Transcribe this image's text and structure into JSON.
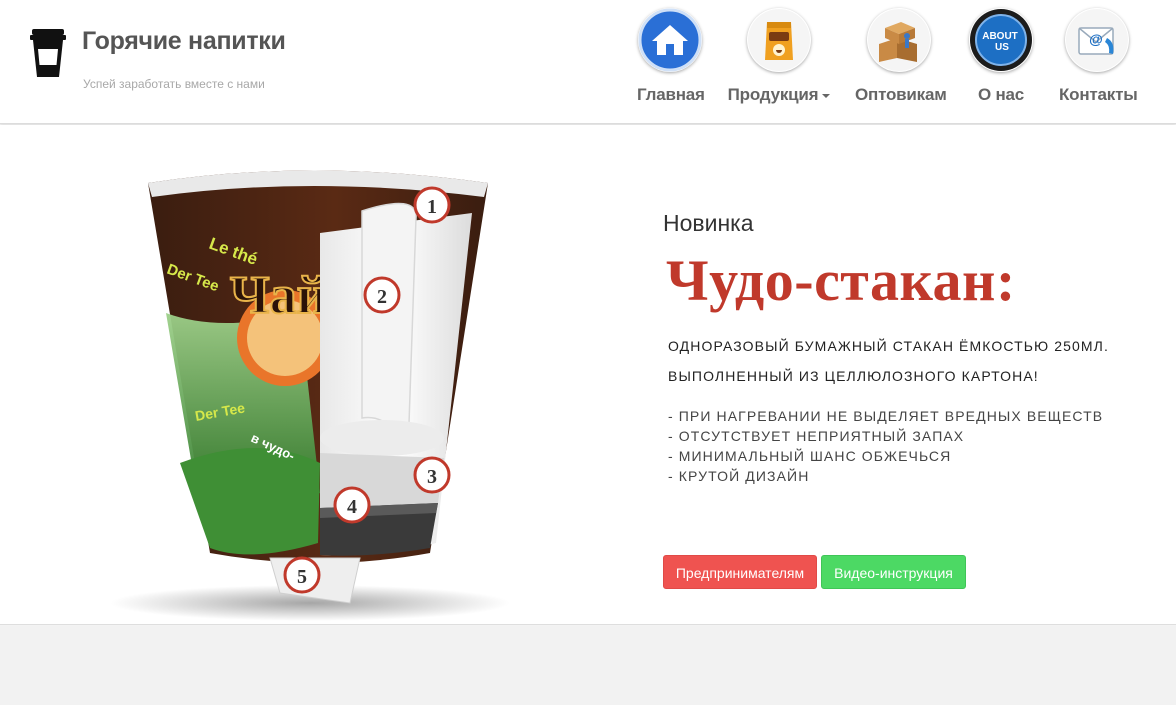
{
  "brand": {
    "title": "Горячие напитки",
    "tagline": "Успей заработать вместе с нами",
    "logo_icon": "coffee-cup-icon"
  },
  "nav": {
    "items": [
      {
        "label": "Главная",
        "icon": "home-icon",
        "dropdown": false
      },
      {
        "label": "Продукция",
        "icon": "coffee-pack-icon",
        "dropdown": true
      },
      {
        "label": "Оптовикам",
        "icon": "boxes-icon",
        "dropdown": false
      },
      {
        "label": "О нас",
        "icon": "about-us-icon",
        "dropdown": false
      },
      {
        "label": "Контакты",
        "icon": "envelope-phone-icon",
        "dropdown": false
      }
    ],
    "about_icon_text": "ABOUT US"
  },
  "hero": {
    "kicker": "Новинка",
    "headline": "Чудо-стакан:",
    "description": [
      "ОДНОРАЗОВЫЙ БУМАЖНЫЙ СТАКАН ЁМКОСТЬЮ 250МЛ.",
      "ВЫПОЛНЕННЫЙ ИЗ ЦЕЛЛЮЛОЗНОГО КАРТОНА!"
    ],
    "features": [
      "- ПРИ НАГРЕВАНИИ НЕ ВЫДЕЛЯЕТ ВРЕДНЫХ ВЕЩЕСТВ",
      "- ОТСУТСТВУЕТ НЕПРИЯТНЫЙ ЗАПАХ",
      "- МИНИМАЛЬНЫЙ ШАНС ОБЖЕЧЬСЯ",
      "- КРУТОЙ ДИЗАЙН"
    ],
    "buttons": {
      "entrepreneurs": "Предпринимателям",
      "video": "Видео-инструкция"
    },
    "cup": {
      "markers": [
        "1",
        "2",
        "3",
        "4",
        "5"
      ],
      "print_text": [
        "Le thé",
        "Der Tee",
        "Чай",
        "в чудо-"
      ]
    }
  },
  "colors": {
    "accent_red": "#c0392b",
    "button_red": "#ef5350",
    "button_green": "#4cd964",
    "nav_text": "#666666"
  }
}
